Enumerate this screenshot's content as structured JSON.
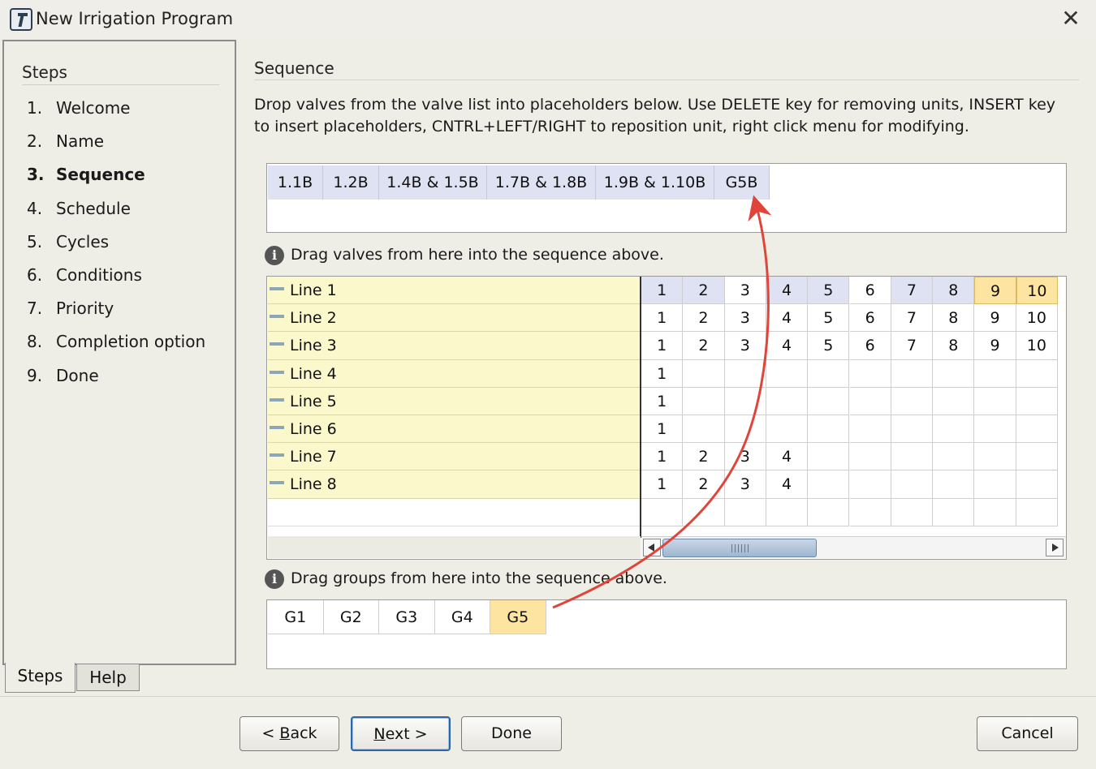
{
  "window": {
    "title": "New Irrigation Program",
    "close_symbol": "✕"
  },
  "steps": {
    "heading": "Steps",
    "items": [
      {
        "num": "1.",
        "label": "Welcome"
      },
      {
        "num": "2.",
        "label": "Name"
      },
      {
        "num": "3.",
        "label": "Sequence"
      },
      {
        "num": "4.",
        "label": "Schedule"
      },
      {
        "num": "5.",
        "label": "Cycles"
      },
      {
        "num": "6.",
        "label": "Conditions"
      },
      {
        "num": "7.",
        "label": "Priority"
      },
      {
        "num": "8.",
        "label": "Completion option"
      },
      {
        "num": "9.",
        "label": "Done"
      }
    ],
    "active_index": 2,
    "tabs": {
      "steps": "Steps",
      "help": "Help"
    }
  },
  "sequence": {
    "title": "Sequence",
    "instructions": "Drop valves from the valve list into placeholders below. Use DELETE key for removing units, INSERT key to insert placeholders, CNTRL+LEFT/RIGHT to reposition unit, right click menu for modifying.",
    "items": [
      "1.1B",
      "1.2B",
      "1.4B & 1.5B",
      "1.7B & 1.8B",
      "1.9B & 1.10B",
      "G5B"
    ]
  },
  "valves": {
    "info": "Drag valves from here into the sequence above.",
    "lines": [
      {
        "label": "Line 1",
        "cells": [
          "1",
          "2",
          "3",
          "4",
          "5",
          "6",
          "7",
          "8",
          "9",
          "10"
        ]
      },
      {
        "label": "Line 2",
        "cells": [
          "1",
          "2",
          "3",
          "4",
          "5",
          "6",
          "7",
          "8",
          "9",
          "10"
        ]
      },
      {
        "label": "Line 3",
        "cells": [
          "1",
          "2",
          "3",
          "4",
          "5",
          "6",
          "7",
          "8",
          "9",
          "10"
        ]
      },
      {
        "label": "Line 4",
        "cells": [
          "1"
        ]
      },
      {
        "label": "Line 5",
        "cells": [
          "1"
        ]
      },
      {
        "label": "Line 6",
        "cells": [
          "1"
        ]
      },
      {
        "label": "Line 7",
        "cells": [
          "1",
          "2",
          "3",
          "4"
        ]
      },
      {
        "label": "Line 8",
        "cells": [
          "1",
          "2",
          "3",
          "4"
        ]
      }
    ],
    "line1_used_columns": [
      1,
      2,
      4,
      5,
      7,
      8
    ],
    "line1_selected_columns": [
      9,
      10
    ]
  },
  "groups": {
    "info": "Drag groups from here into the sequence above.",
    "items": [
      "G1",
      "G2",
      "G3",
      "G4",
      "G5"
    ],
    "selected": "G5"
  },
  "buttons": {
    "back": "< Back",
    "next": "Next >",
    "done": "Done",
    "cancel": "Cancel"
  },
  "colors": {
    "used": "#dfe2f3",
    "selected": "#fde4a0",
    "line_bg": "#fbf8cc",
    "annotation_arrow": "#e0453a"
  }
}
